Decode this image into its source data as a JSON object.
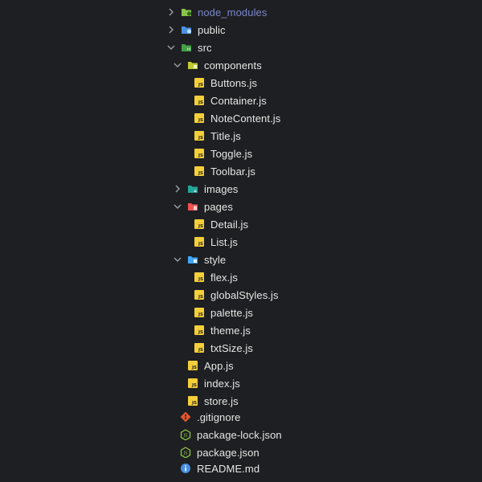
{
  "tree": [
    {
      "label": "node_modules",
      "kind": "folder",
      "state": "collapsed",
      "icon": "node-folder-icon",
      "dim": true
    },
    {
      "label": "public",
      "kind": "folder",
      "state": "collapsed",
      "icon": "public-folder-icon"
    },
    {
      "label": "src",
      "kind": "folder",
      "state": "expanded",
      "icon": "src-folder-icon"
    },
    {
      "label": "components",
      "kind": "folder",
      "state": "expanded",
      "icon": "components-folder-icon"
    },
    {
      "label": "Buttons.js",
      "kind": "file",
      "icon": "js-file-icon"
    },
    {
      "label": "Container.js",
      "kind": "file",
      "icon": "js-file-icon"
    },
    {
      "label": "NoteContent.js",
      "kind": "file",
      "icon": "js-file-icon"
    },
    {
      "label": "Title.js",
      "kind": "file",
      "icon": "js-file-icon"
    },
    {
      "label": "Toggle.js",
      "kind": "file",
      "icon": "js-file-icon"
    },
    {
      "label": "Toolbar.js",
      "kind": "file",
      "icon": "js-file-icon"
    },
    {
      "label": "images",
      "kind": "folder",
      "state": "collapsed",
      "icon": "images-folder-icon"
    },
    {
      "label": "pages",
      "kind": "folder",
      "state": "expanded",
      "icon": "pages-folder-icon"
    },
    {
      "label": "Detail.js",
      "kind": "file",
      "icon": "js-file-icon"
    },
    {
      "label": "List.js",
      "kind": "file",
      "icon": "js-file-icon"
    },
    {
      "label": "style",
      "kind": "folder",
      "state": "expanded",
      "icon": "style-folder-icon"
    },
    {
      "label": "flex.js",
      "kind": "file",
      "icon": "js-file-icon"
    },
    {
      "label": "globalStyles.js",
      "kind": "file",
      "icon": "js-file-icon"
    },
    {
      "label": "palette.js",
      "kind": "file",
      "icon": "js-file-icon"
    },
    {
      "label": "theme.js",
      "kind": "file",
      "icon": "js-file-icon"
    },
    {
      "label": "txtSize.js",
      "kind": "file",
      "icon": "js-file-icon"
    },
    {
      "label": "App.js",
      "kind": "file",
      "icon": "js-file-icon"
    },
    {
      "label": "index.js",
      "kind": "file",
      "icon": "js-file-icon"
    },
    {
      "label": "store.js",
      "kind": "file",
      "icon": "js-file-icon"
    },
    {
      "label": ".gitignore",
      "kind": "file",
      "icon": "git-icon"
    },
    {
      "label": "package-lock.json",
      "kind": "file",
      "icon": "nodejs-icon"
    },
    {
      "label": "package.json",
      "kind": "file",
      "icon": "nodejs-icon"
    },
    {
      "label": "README.md",
      "kind": "file",
      "icon": "info-icon"
    }
  ],
  "colors": {
    "background": "#1e1f22",
    "text": "#e6e6e6",
    "dim_text": "#7b86c9",
    "js": "#f4cf3a",
    "git": "#e4572e",
    "node": "#8bc34a",
    "info": "#4a90e2",
    "chevron": "#9aa0a6"
  }
}
